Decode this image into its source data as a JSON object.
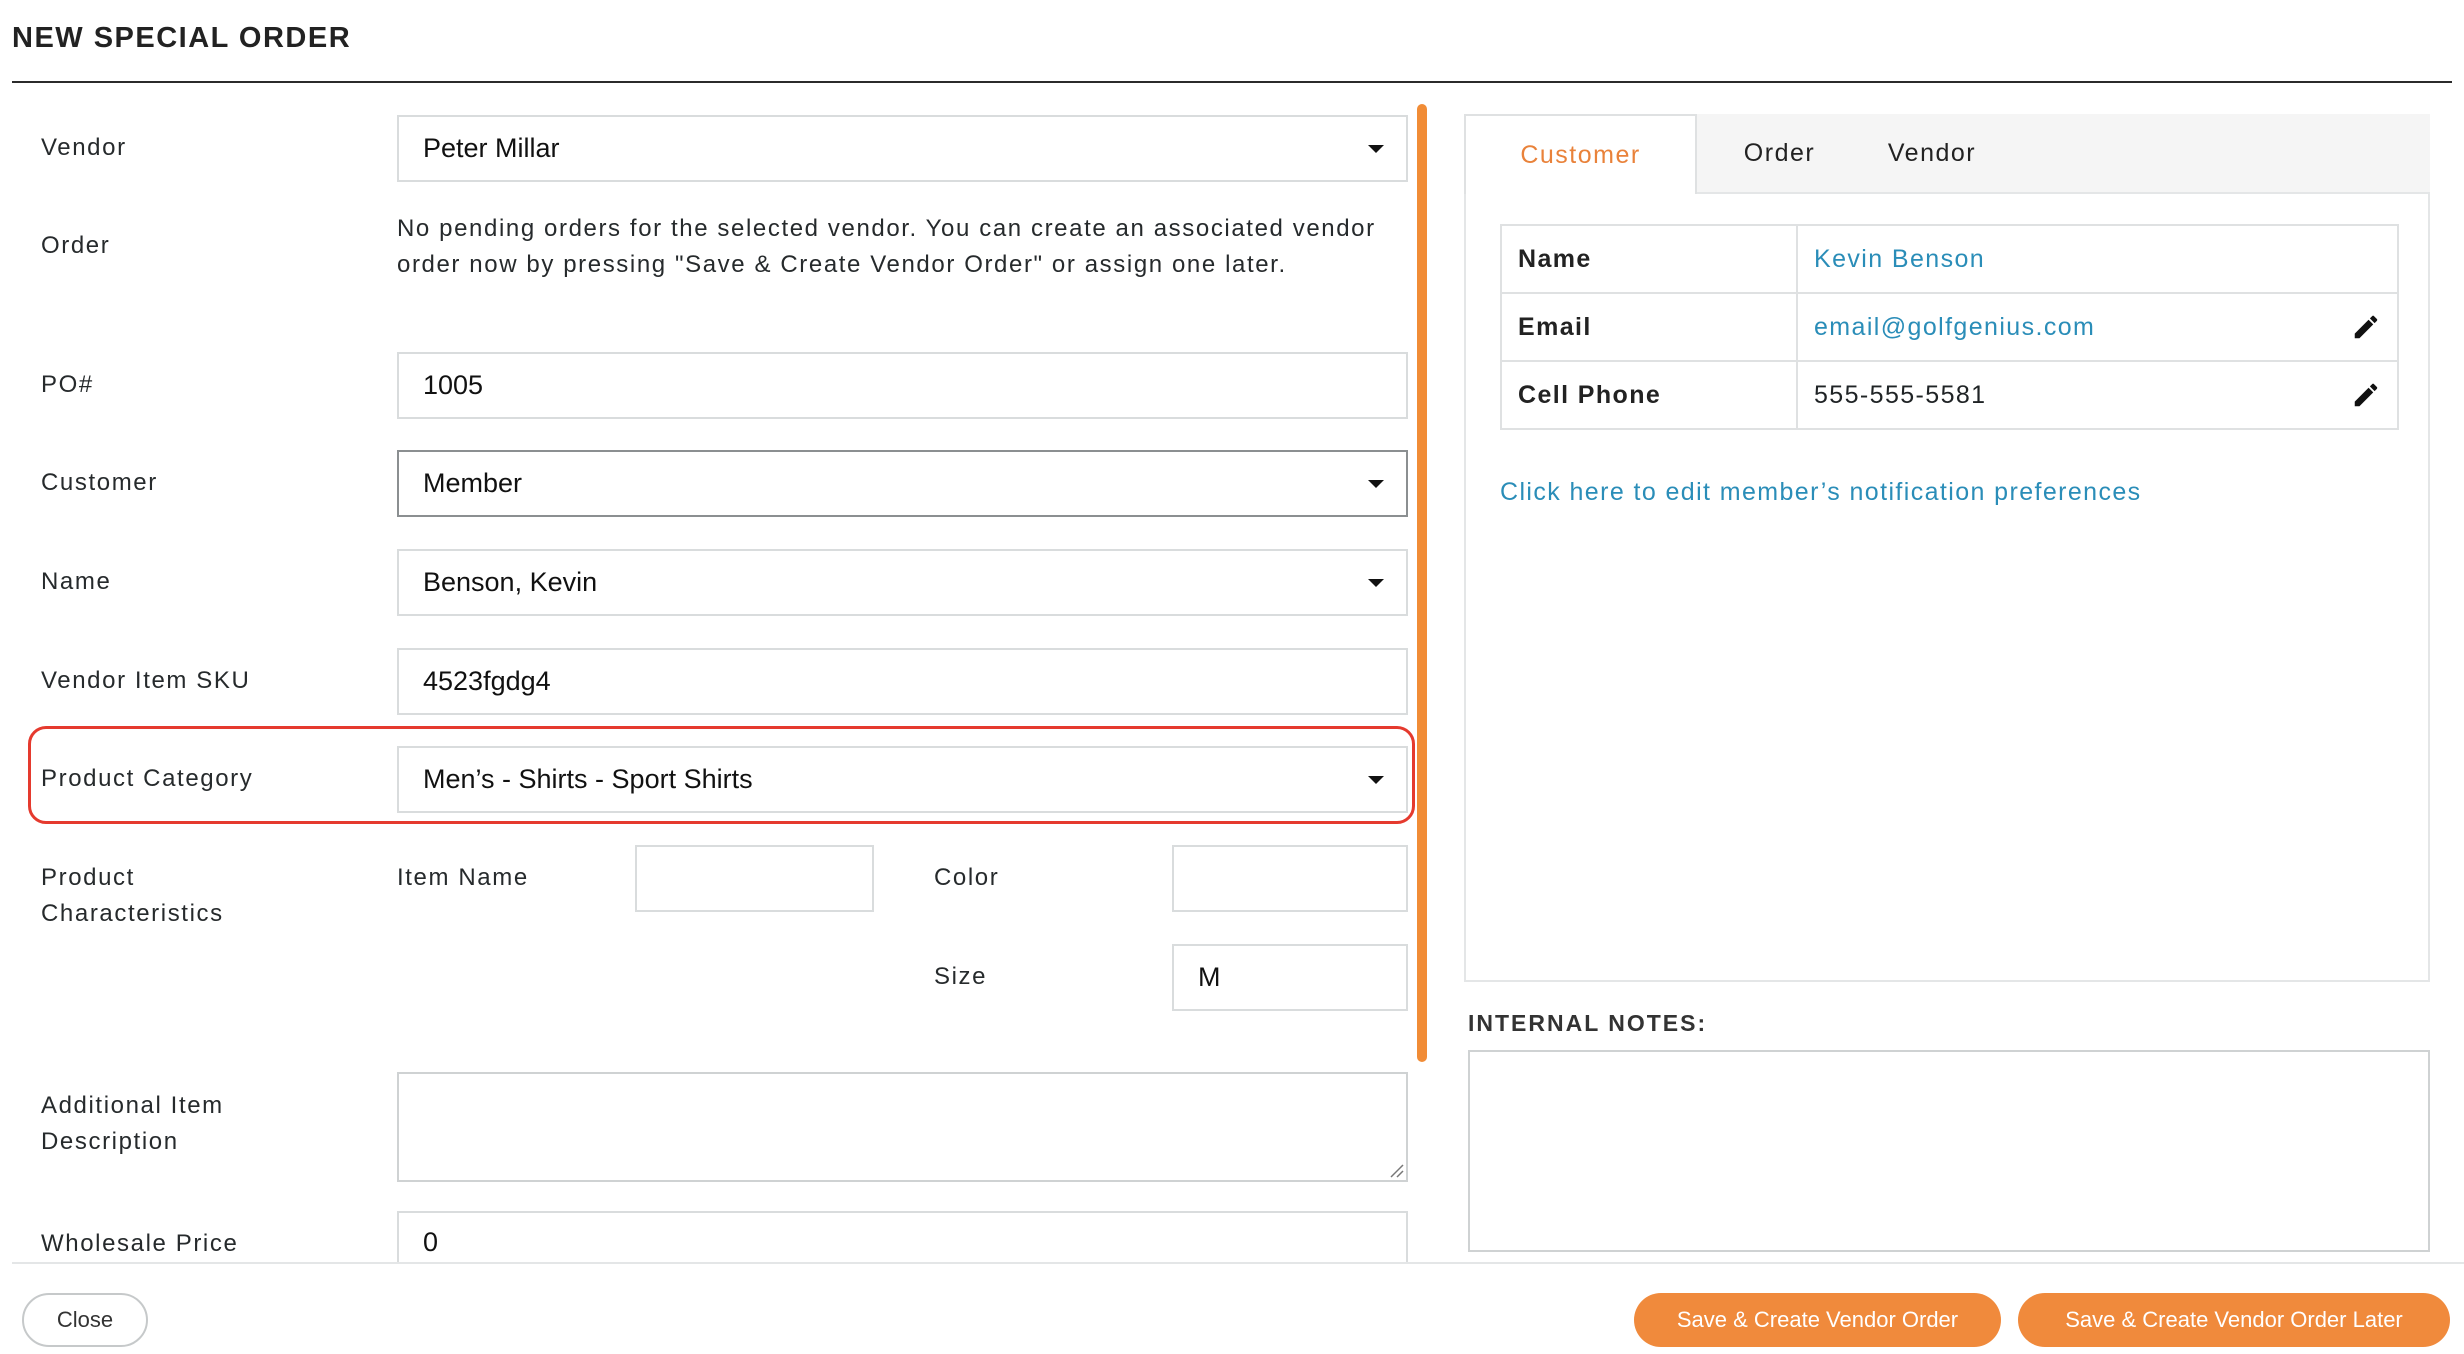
{
  "header": {
    "title": "NEW SPECIAL ORDER"
  },
  "form": {
    "vendor": {
      "label": "Vendor",
      "value": "Peter Millar"
    },
    "order": {
      "label": "Order",
      "note": "No pending orders for the selected vendor. You can create an associated vendor order now by pressing \"Save & Create Vendor Order\" or assign one later."
    },
    "po": {
      "label": "PO#",
      "value": "1005"
    },
    "customer": {
      "label": "Customer",
      "value": "Member"
    },
    "name": {
      "label": "Name",
      "value": "Benson, Kevin"
    },
    "sku": {
      "label": "Vendor Item SKU",
      "value": "4523fgdg4"
    },
    "category": {
      "label": "Product Category",
      "value": "Men’s - Shirts - Sport Shirts"
    },
    "characteristics": {
      "label_line1": "Product",
      "label_line2": "Characteristics",
      "item_name_label": "Item Name",
      "item_name_value": "",
      "color_label": "Color",
      "color_value": "",
      "size_label": "Size",
      "size_value": "M"
    },
    "description": {
      "label_line1": "Additional Item",
      "label_line2": "Description",
      "value": ""
    },
    "wholesale": {
      "label": "Wholesale Price",
      "value": "0"
    }
  },
  "right_panel": {
    "tabs": [
      {
        "label": "Customer",
        "active": true
      },
      {
        "label": "Order",
        "active": false
      },
      {
        "label": "Vendor",
        "active": false
      }
    ],
    "info": [
      {
        "key": "Name",
        "value": "Kevin Benson",
        "editable": false
      },
      {
        "key": "Email",
        "value": "email@golfgenius.com",
        "editable": true
      },
      {
        "key": "Cell Phone",
        "value": "555-555-5581",
        "editable": true
      }
    ],
    "notification_link": "Click here to edit member’s notification preferences",
    "notes_label": "INTERNAL NOTES:",
    "notes_value": ""
  },
  "footer": {
    "close_label": "Close",
    "save_create_label": "Save & Create Vendor Order",
    "save_later_label": "Save & Create Vendor Order Later"
  },
  "colors": {
    "accent": "#f08a3c",
    "link": "#2a8db8",
    "highlight": "#e53a2e"
  },
  "icons": {
    "edit": "pencil-icon",
    "dropdown": "caret-down-icon"
  }
}
